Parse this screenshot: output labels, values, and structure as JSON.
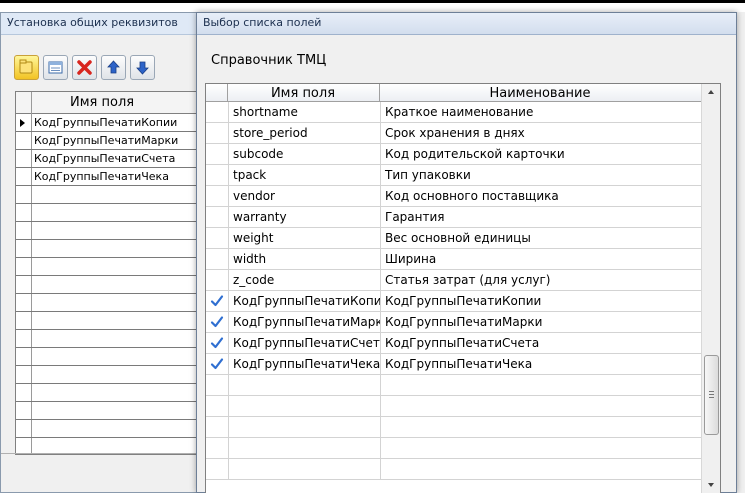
{
  "background_window": {
    "title": "Установка общих реквизитов",
    "grid_header": "Имя поля",
    "rows": [
      "КодГруппыПечатиКопии",
      "КодГруппыПечатиМарки",
      "КодГруппыПечатиСчета",
      "КодГруппыПечатиЧека"
    ],
    "toolbar_icons": [
      "folder-icon",
      "list-icon",
      "delete-icon",
      "arrow-up-icon",
      "arrow-down-icon"
    ]
  },
  "dialog": {
    "title": "Выбор списка полей",
    "subtitle": "Справочник ТМЦ",
    "columns": {
      "field_name": "Имя поля",
      "description": "Наименование"
    },
    "rows": [
      {
        "checked": false,
        "field": "shortname",
        "desc": "Краткое наименование"
      },
      {
        "checked": false,
        "field": "store_period",
        "desc": "Срок хранения в днях"
      },
      {
        "checked": false,
        "field": "subcode",
        "desc": "Код родительской карточки"
      },
      {
        "checked": false,
        "field": "tpack",
        "desc": "Тип упаковки"
      },
      {
        "checked": false,
        "field": "vendor",
        "desc": "Код основного поставщика"
      },
      {
        "checked": false,
        "field": "warranty",
        "desc": "Гарантия"
      },
      {
        "checked": false,
        "field": "weight",
        "desc": "Вес основной единицы"
      },
      {
        "checked": false,
        "field": "width",
        "desc": "Ширина"
      },
      {
        "checked": false,
        "field": "z_code",
        "desc": "Статья затрат (для услуг)"
      },
      {
        "checked": true,
        "field": "КодГруппыПечатиКопии",
        "desc": "КодГруппыПечатиКопии"
      },
      {
        "checked": true,
        "field": "КодГруппыПечатиМарки",
        "desc": "КодГруппыПечатиМарки"
      },
      {
        "checked": true,
        "field": "КодГруппыПечатиСчета",
        "desc": "КодГруппыПечатиСчета"
      },
      {
        "checked": true,
        "field": "КодГруппыПечатиЧека",
        "desc": "КодГруппыПечатиЧека"
      }
    ],
    "checkmark_color": "#2f6fd1"
  }
}
